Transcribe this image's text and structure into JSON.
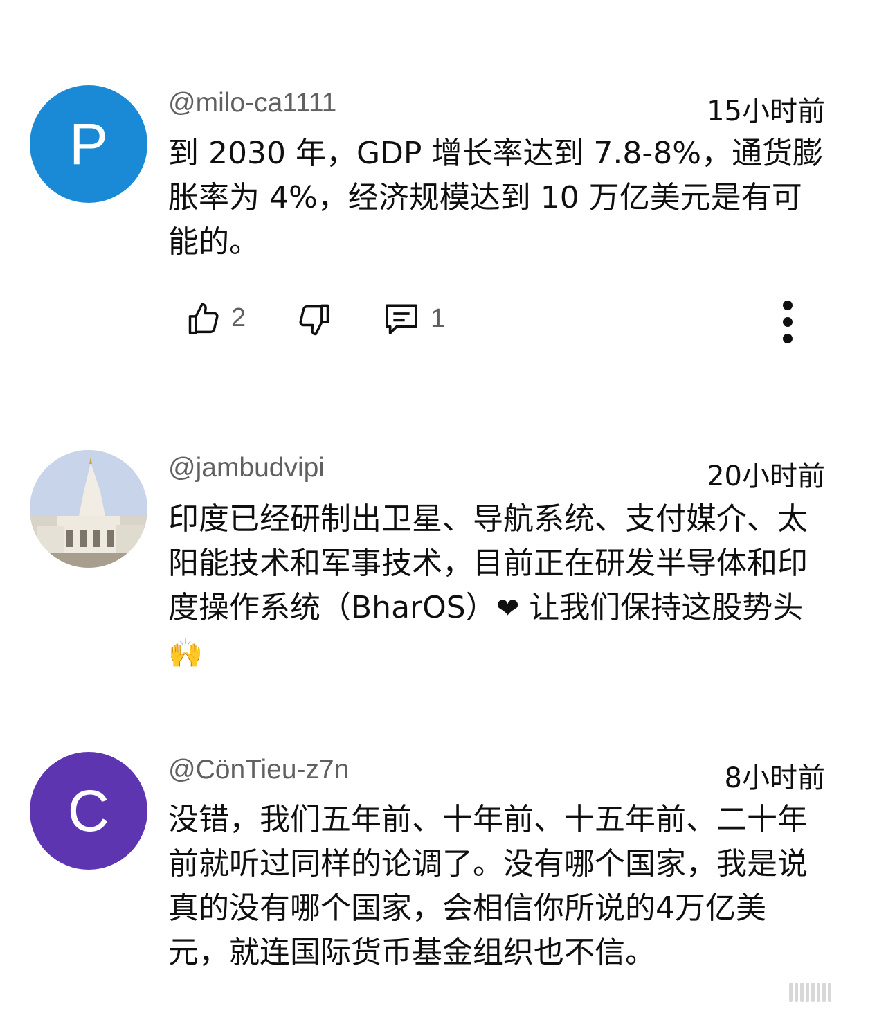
{
  "comments": [
    {
      "avatar_letter": "P",
      "avatar_color": "#1a8ad6",
      "author": "@milo-ca1111",
      "time": "15小时前",
      "text": "到 2030 年，GDP 增长率达到 7.8-8%，通货膨胀率为 4%，经济规模达到 10 万亿美元是有可能的。",
      "likes": "2",
      "replies": "1"
    },
    {
      "avatar_image": "temple-photo",
      "author": "@jambudvipi",
      "time": "20小时前",
      "text_before": "印度已经研制出卫星、导航系统、支付媒介、太阳能技术和军事技术，目前正在研发半导体和印度操作系统（BharOS）",
      "heart": "❤",
      "text_middle": " 让我们保持这股势头",
      "emoji": "🙌"
    },
    {
      "avatar_letter": "C",
      "avatar_color": "#5e35b1",
      "author": "@CönTieu-z7n",
      "time": "8小时前",
      "text": "没错，我们五年前、十年前、十五年前、二十年前就听过同样的论调了。没有哪个国家，我是说真的没有哪个国家，会相信你所说的4万亿美元，就连国际货币基金组织也不信。"
    }
  ],
  "icons": {
    "like": "thumbs-up-icon",
    "dislike": "thumbs-down-icon",
    "reply": "comment-icon",
    "menu": "more-vertical-icon"
  }
}
